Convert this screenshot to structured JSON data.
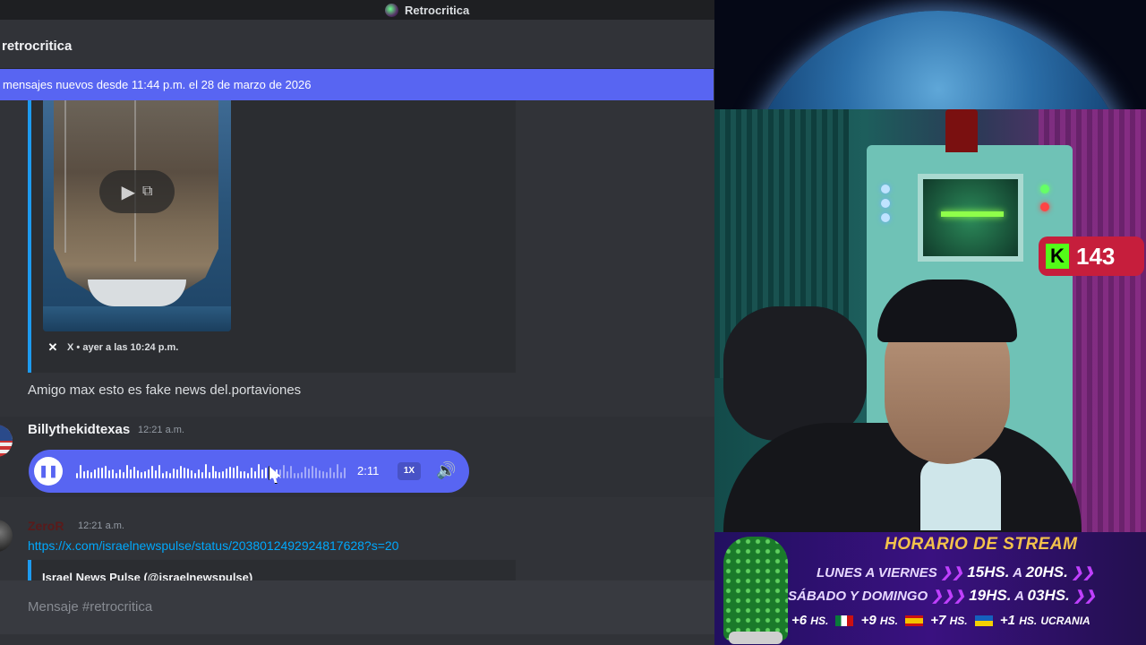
{
  "titlebar": {
    "title": "Retrocritica"
  },
  "channel": {
    "name": "retrocritica"
  },
  "new_messages_bar": {
    "text": "mensajes nuevos desde 11:44 p.m. el 28 de marzo de 2026"
  },
  "embed": {
    "source": "X",
    "separator": "•",
    "timestamp": "ayer a las 10:24 p.m."
  },
  "messages": [
    {
      "text": "Amigo max esto es fake news del.portaviones"
    },
    {
      "author": "Billythekidtexas",
      "timestamp": "12:21 a.m.",
      "voice": {
        "duration": "2:11",
        "speed": "1X",
        "progress": 0.74
      }
    },
    {
      "author": "ZeroR",
      "timestamp": "12:21 a.m.",
      "link": "https://x.com/israelnewspulse/status/2038012492924817628?s=20",
      "embed_title": "Israel News Pulse (@israelnewspulse)"
    }
  ],
  "composer": {
    "placeholder": "Mensaje #retrocritica"
  },
  "stream": {
    "kick_count": "143",
    "kick_letter": "K",
    "schedule": {
      "title": "HORARIO DE STREAM",
      "row1_days": "LUNES A VIERNES",
      "row1_start": "15HS.",
      "row1_to": "A",
      "row1_end": "20HS.",
      "row2_days": "SÁBADO Y DOMINGO",
      "row2_start": "19HS.",
      "row2_to": "A",
      "row2_end": "03HS.",
      "tz1": "+6",
      "tz2": "+9",
      "tz3": "+7",
      "tz4": "+1",
      "hs": "HS.",
      "country4": "UCRANIA"
    }
  },
  "colors": {
    "accent": "#5865f2",
    "link": "#00a8fc",
    "kick": "#53fc18"
  }
}
